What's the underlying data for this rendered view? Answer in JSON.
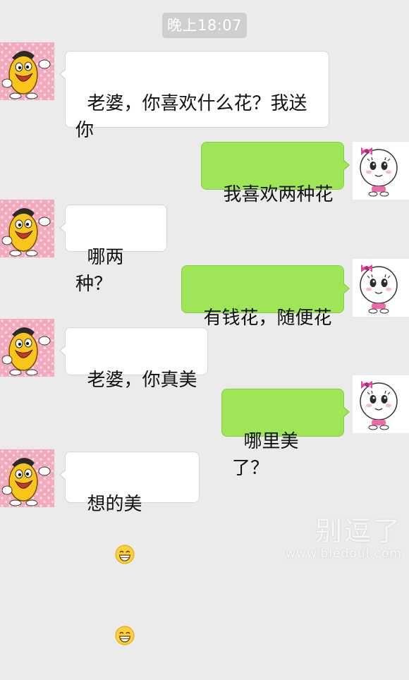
{
  "chat": {
    "timestamp": "晚上18:07",
    "messages": [
      {
        "side": "left",
        "avatar": "yellow-bean-avatar",
        "text": "老婆，你喜欢什么花？我送你"
      },
      {
        "side": "right",
        "avatar": "cartoon-girl-avatar",
        "text": "我喜欢两种花"
      },
      {
        "side": "left",
        "avatar": "yellow-bean-avatar",
        "text": "哪两种？"
      },
      {
        "side": "right",
        "avatar": "cartoon-girl-avatar",
        "text": "有钱花，随便花"
      },
      {
        "side": "left",
        "avatar": "yellow-bean-avatar",
        "text": "老婆，你真美"
      },
      {
        "side": "right",
        "avatar": "cartoon-girl-avatar",
        "text": "哪里美了？"
      },
      {
        "side": "left",
        "avatar": "yellow-bean-avatar",
        "text": "想的美",
        "emojis": [
          "grinning-face-emoji",
          "grinning-face-emoji"
        ]
      }
    ]
  },
  "watermark": {
    "main": "别逗了",
    "site": "www.biedoul.com"
  },
  "colors": {
    "background": "#ebebeb",
    "sent_bubble": "#9fe657",
    "received_bubble": "#ffffff",
    "timestamp_pill": "#cfcfcf",
    "avatar_pink": "#f5b6c6"
  }
}
